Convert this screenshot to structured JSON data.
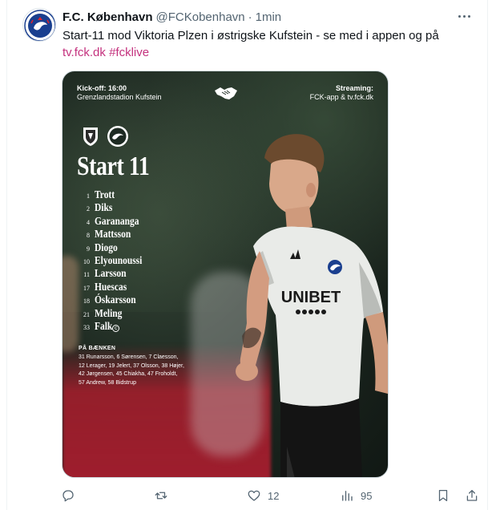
{
  "tweet": {
    "display_name": "F.C. København",
    "handle": "@FCKobenhavn",
    "separator": "·",
    "time": "1min",
    "text_line1": "Start-11 mod Viktoria Plzen i østrigske Kufstein - se med i appen og på",
    "link_text": "tv.fck.dk",
    "hashtag": "#fcklive"
  },
  "media": {
    "kickoff_label": "Kick-off: 16:00",
    "venue": "Grenzlandstadion Kufstein",
    "streaming_label": "Streaming:",
    "streaming_value": "FCK-app & tv.fck.dk",
    "title": "Start 11",
    "players": [
      {
        "num": "1",
        "name": "Trott"
      },
      {
        "num": "2",
        "name": "Diks"
      },
      {
        "num": "4",
        "name": "Garananga"
      },
      {
        "num": "8",
        "name": "Mattsson"
      },
      {
        "num": "9",
        "name": "Diogo"
      },
      {
        "num": "10",
        "name": "Elyounoussi"
      },
      {
        "num": "11",
        "name": "Larsson"
      },
      {
        "num": "17",
        "name": "Huescas"
      },
      {
        "num": "18",
        "name": "Óskarsson"
      },
      {
        "num": "21",
        "name": "Meling"
      },
      {
        "num": "33",
        "name": "Falk"
      }
    ],
    "captain_mark": "c",
    "bench_title": "PÅ BÆNKEN",
    "bench_lines": [
      "31 Runarsson, 6 Sørensen, 7 Claesson,",
      "12 Lerager, 19 Jelert, 37 Olsson, 38 Højer,",
      "42 Jørgensen, 45 Chiakha, 47 Froholdt,",
      "57 Andrew, 58 Bidstrup"
    ],
    "shirt_sponsor": "UNIBET"
  },
  "actions": {
    "reply_count": "",
    "retweet_count": "",
    "like_count": "12",
    "views_count": "95"
  },
  "colors": {
    "link": "#c4327e",
    "muted": "#536471",
    "text": "#0f1419"
  }
}
